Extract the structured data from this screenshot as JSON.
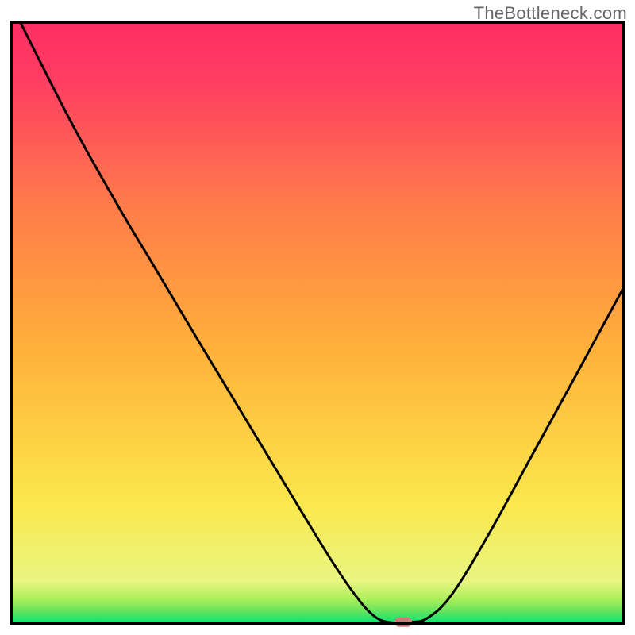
{
  "watermark": "TheBottleneck.com",
  "chart_data": {
    "type": "line",
    "title": "",
    "xlabel": "",
    "ylabel": "",
    "xlim": [
      0,
      100
    ],
    "ylim": [
      0,
      100
    ],
    "grid": false,
    "legend": false,
    "gradient_stops": [
      {
        "pos": 0.0,
        "color": "#00e676"
      },
      {
        "pos": 0.02,
        "color": "#5fe35f"
      },
      {
        "pos": 0.04,
        "color": "#a8ef5a"
      },
      {
        "pos": 0.07,
        "color": "#e8f581"
      },
      {
        "pos": 0.2,
        "color": "#fbe84c"
      },
      {
        "pos": 0.45,
        "color": "#ffb23a"
      },
      {
        "pos": 0.7,
        "color": "#ff7a4a"
      },
      {
        "pos": 0.9,
        "color": "#ff3e62"
      },
      {
        "pos": 1.0,
        "color": "#ff2e63"
      }
    ],
    "curve_points": [
      {
        "x": 1.5,
        "y": 100.0
      },
      {
        "x": 10.0,
        "y": 83.0
      },
      {
        "x": 18.0,
        "y": 68.5
      },
      {
        "x": 23.0,
        "y": 60.0
      },
      {
        "x": 30.0,
        "y": 48.0
      },
      {
        "x": 38.0,
        "y": 34.5
      },
      {
        "x": 46.0,
        "y": 21.0
      },
      {
        "x": 52.0,
        "y": 11.0
      },
      {
        "x": 56.0,
        "y": 5.0
      },
      {
        "x": 59.0,
        "y": 1.5
      },
      {
        "x": 61.5,
        "y": 0.3
      },
      {
        "x": 65.0,
        "y": 0.3
      },
      {
        "x": 68.0,
        "y": 1.0
      },
      {
        "x": 72.0,
        "y": 5.0
      },
      {
        "x": 78.0,
        "y": 15.0
      },
      {
        "x": 85.0,
        "y": 28.0
      },
      {
        "x": 92.0,
        "y": 41.0
      },
      {
        "x": 100.0,
        "y": 56.0
      }
    ],
    "marker": {
      "x": 64.0,
      "y": 0.3,
      "color": "#d07a7a"
    },
    "frame_color": "#000000",
    "curve_color": "#000000"
  }
}
